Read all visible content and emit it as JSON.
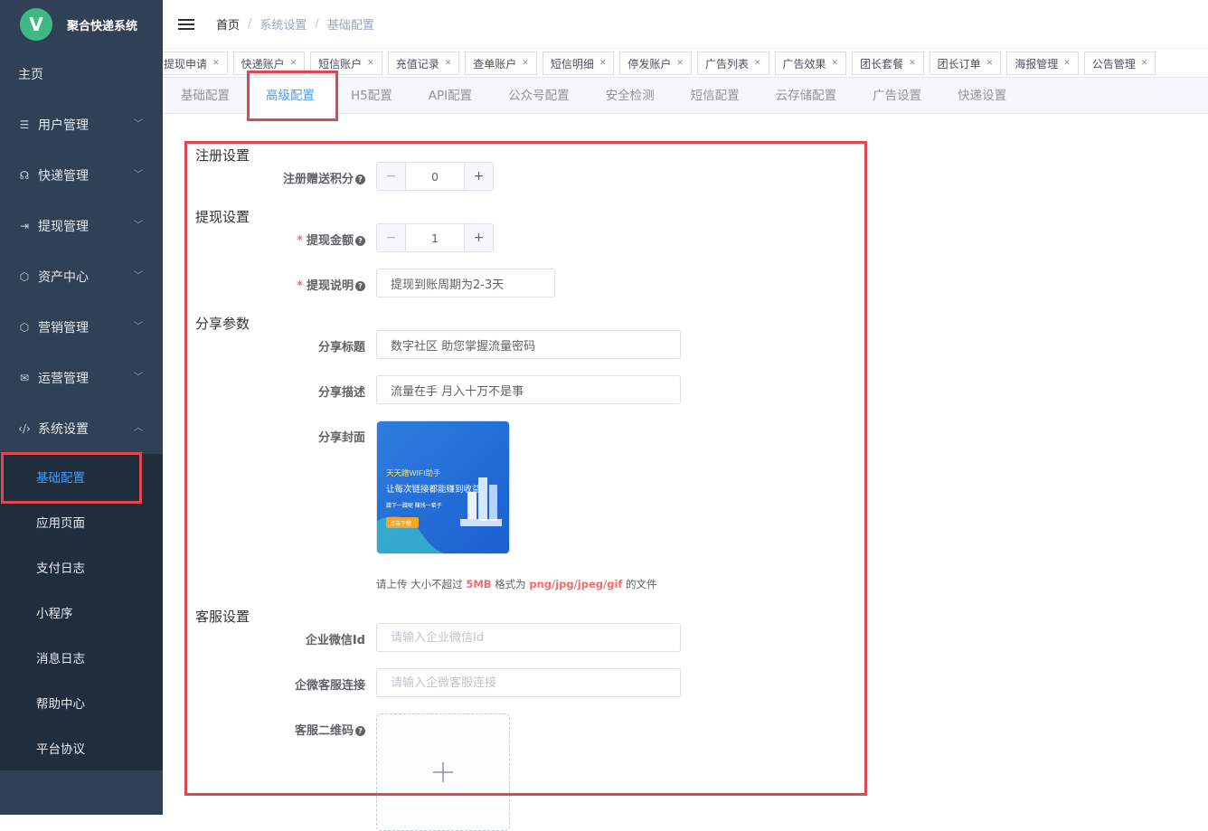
{
  "app": {
    "logo_letter": "V",
    "title": "聚合快递系统"
  },
  "sidebar": {
    "home": "主页",
    "items": [
      {
        "label": "用户管理",
        "icon": "list-icon"
      },
      {
        "label": "快递管理",
        "icon": "headset-icon"
      },
      {
        "label": "提现管理",
        "icon": "withdraw-icon"
      },
      {
        "label": "资产中心",
        "icon": "cube-icon"
      },
      {
        "label": "营销管理",
        "icon": "cube-icon"
      },
      {
        "label": "运营管理",
        "icon": "mail-icon"
      },
      {
        "label": "系统设置",
        "icon": "code-icon"
      }
    ],
    "sub": [
      "基础配置",
      "应用页面",
      "支付日志",
      "小程序",
      "消息日志",
      "帮助中心",
      "平台协议"
    ]
  },
  "breadcrumb": [
    "首页",
    "系统设置",
    "基础配置"
  ],
  "tags": [
    "提现申请",
    "快递账户",
    "短信账户",
    "充值记录",
    "查单账户",
    "短信明细",
    "停发账户",
    "广告列表",
    "广告效果",
    "团长套餐",
    "团长订单",
    "海报管理",
    "公告管理"
  ],
  "tabs": [
    "基础配置",
    "高级配置",
    "H5配置",
    "API配置",
    "公众号配置",
    "安全检测",
    "短信配置",
    "云存储配置",
    "广告设置",
    "快递设置"
  ],
  "form": {
    "register": {
      "title": "注册设置",
      "points_label": "注册赠送积分",
      "points_value": "0"
    },
    "withdraw": {
      "title": "提现设置",
      "amount_label": "提现金额",
      "amount_value": "1",
      "desc_label": "提现说明",
      "desc_value": "提现到账周期为2-3天"
    },
    "share": {
      "title": "分享参数",
      "title_label": "分享标题",
      "title_value": "数字社区 助您掌握流量密码",
      "desc_label": "分享描述",
      "desc_value": "流量在手 月入十万不是事",
      "cover_label": "分享封面",
      "cover_text": [
        "天天蹭WIFI助手",
        "让每次链接都能赚到收益",
        "蹭下一蹭呢 赚钱一辈子",
        "点击下载"
      ],
      "hint_pre": "请上传 大小不超过",
      "hint_size": "5MB",
      "hint_mid": "格式为",
      "hint_fmt": "png/jpg/jpeg/gif",
      "hint_post": "的文件"
    },
    "service": {
      "title": "客服设置",
      "wecom_label": "企业微信Id",
      "wecom_placeholder": "请输入企业微信Id",
      "link_label": "企微客服连接",
      "link_placeholder": "请输入企微客服连接",
      "qr_label": "客服二维码"
    }
  },
  "colors": {
    "sidebar": "#304156",
    "active": "#409eff",
    "highlight": "#e0484f",
    "accent_logo": "#3fb983"
  }
}
